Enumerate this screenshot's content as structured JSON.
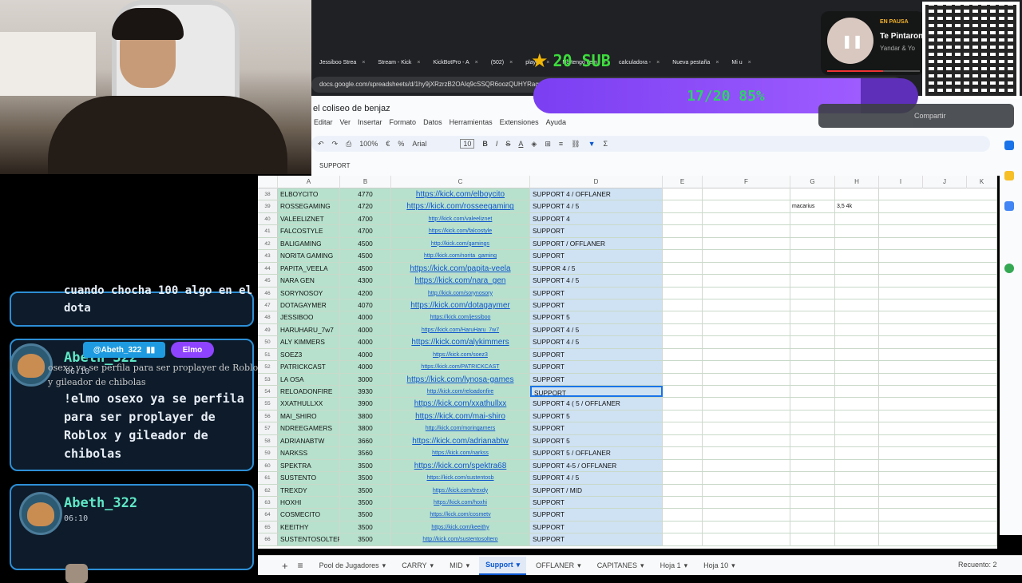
{
  "browser": {
    "tabs": [
      "Jessiboo Strea",
      "Stream - Kick",
      "KickBotPro - A",
      "(502)",
      "player",
      "No tengo tiem",
      "calculadora -",
      "Nueva pestaña",
      "Mi u"
    ],
    "url": "docs.google.com/spreadsheets/d/1hy9jXRzrzB2OAIq9cSSQR6oozQUHYRagcCXHCaafrF"
  },
  "doc": {
    "title": "el coliseo de benjaz",
    "menu": [
      "Editar",
      "Ver",
      "Insertar",
      "Formato",
      "Datos",
      "Herramientas",
      "Extensiones",
      "Ayuda"
    ],
    "zoom": "100%",
    "font": "Arial",
    "font_size": "10",
    "formula": "SUPPORT",
    "share_label": "Compartir"
  },
  "overlay": {
    "sub_goal": "20 SUB",
    "progress_text": "17/20  85%",
    "progress_fraction": 0.85,
    "music_status": "EN PAUSA",
    "music_title": "Te Pintaron",
    "music_artist": "Yandar & Yo"
  },
  "chat": {
    "m1_text": "cuando chocha 100 algo en el dota",
    "m2_user": "Abeth_322",
    "m2_pill_user": "@Abeth_322",
    "m2_pill_tts": "Elmo",
    "m2_tts": "osexo ya se perfila para ser proplayer de Roblox y gileador de chibolas",
    "m2_text": "!elmo osexo ya se perfila para ser proplayer de Roblox y gileador de chibolas",
    "m3_user": "Abeth_322",
    "m3_time": "06:10",
    "m2_time": "06:10"
  },
  "columns": [
    "A",
    "B",
    "C",
    "D",
    "E",
    "F",
    "G",
    "H",
    "I",
    "J",
    "K"
  ],
  "rows": [
    {
      "n": "38",
      "a": "ELBOYCITO",
      "b": "4770",
      "c": "https://kick.com/elboycito",
      "d": "SUPPORT 4 / OFFLANER",
      "s": "big"
    },
    {
      "n": "39",
      "a": "ROSSEGAMING",
      "b": "4720",
      "c": "https://kick.com/rosseegaming",
      "d": "SUPPORT 4 / 5",
      "s": "big",
      "g": "macarius",
      "h": "3,5 4k"
    },
    {
      "n": "40",
      "a": "VALEELIZNET",
      "b": "4700",
      "c": "http://kick.com/valeeliznet",
      "d": "SUPPORT 4",
      "s": "sm"
    },
    {
      "n": "41",
      "a": "FALCOSTYLE",
      "b": "4700",
      "c": "https://kick.com/falcostyle",
      "d": "SUPPORT",
      "s": "sm"
    },
    {
      "n": "42",
      "a": "BALIGAMING",
      "b": "4500",
      "c": "http://kick.com/gamings",
      "d": "SUPPORT / OFFLANER",
      "s": "sm"
    },
    {
      "n": "43",
      "a": "NORITA GAMING",
      "b": "4500",
      "c": "http://kick.com/norita_gaming",
      "d": "SUPPORT",
      "s": "sm"
    },
    {
      "n": "44",
      "a": "PAPITA_VEELA",
      "b": "4500",
      "c": "https://kick.com/papita-veela",
      "d": "SUPPOR 4 / 5",
      "s": "big"
    },
    {
      "n": "45",
      "a": "NARA GEN",
      "b": "4300",
      "c": "https://kick.com/nara_gen",
      "d": "SUPPORT 4 / 5",
      "s": "big"
    },
    {
      "n": "46",
      "a": "SORYNOSOY",
      "b": "4200",
      "c": "http://kick.com/sorynosory",
      "d": "SUPPORT",
      "s": "sm"
    },
    {
      "n": "47",
      "a": "DOTAGAYMER",
      "b": "4070",
      "c": "https://kick.com/dotagaymer",
      "d": "SUPPORT",
      "s": "big"
    },
    {
      "n": "48",
      "a": "JESSIBOO",
      "b": "4000",
      "c": "https://kick.com/jessiboo",
      "d": "SUPPORT 5",
      "s": "sm"
    },
    {
      "n": "49",
      "a": "HARUHARU_7w7",
      "b": "4000",
      "c": "https://kick.com/HaruHaru_7w7",
      "d": "SUPPORT 4 / 5",
      "s": "sm"
    },
    {
      "n": "50",
      "a": "ALY KIMMERS",
      "b": "4000",
      "c": "https://kick.com/alykimmers",
      "d": "SUPPORT 4 / 5",
      "s": "big"
    },
    {
      "n": "51",
      "a": "SOEZ3",
      "b": "4000",
      "c": "https://kick.com/soez3",
      "d": "SUPPORT",
      "s": "sm"
    },
    {
      "n": "52",
      "a": "PATRICKCAST",
      "b": "4000",
      "c": "https://kick.com/PATRICKCAST",
      "d": "SUPPORT",
      "s": "sm"
    },
    {
      "n": "53",
      "a": "LA OSA",
      "b": "3000",
      "c": "https://kick.com/lynosa-games",
      "d": "SUPPORT",
      "s": "big"
    },
    {
      "n": "54",
      "a": "RELOADONFIRE",
      "b": "3930",
      "c": "http://kick.com/reloadonfire",
      "d": "SUPPORT",
      "s": "sm"
    },
    {
      "n": "55",
      "a": "XXATHULLXX",
      "b": "3900",
      "c": "https://kick.com/xxathullxx",
      "d": "SUPPORT 4 ( 5 / OFFLANER",
      "s": "big"
    },
    {
      "n": "56",
      "a": "MAI_SHIRO",
      "b": "3800",
      "c": "https://kick.com/mai-shiro",
      "d": "SUPPORT 5",
      "s": "big"
    },
    {
      "n": "57",
      "a": "NDREEGAMERS",
      "b": "3800",
      "c": "http://kick.com/moringamers",
      "d": "SUPPORT",
      "s": "sm"
    },
    {
      "n": "58",
      "a": "ADRIANABTW",
      "b": "3660",
      "c": "https://kick.com/adrianabtw",
      "d": "SUPPORT 5",
      "s": "big"
    },
    {
      "n": "59",
      "a": "NARKSS",
      "b": "3560",
      "c": "https://kick.com/narkss",
      "d": "SUPPORT 5 / OFFLANER",
      "s": "sm"
    },
    {
      "n": "60",
      "a": "SPEKTRA",
      "b": "3500",
      "c": "https://kick.com/spektra68",
      "d": "SUPPORT 4-5 / OFFLANER",
      "s": "big"
    },
    {
      "n": "61",
      "a": "SUSTENTO",
      "b": "3500",
      "c": "https://kick.com/sustentosb",
      "d": "SUPPORT 4 / 5",
      "s": "sm"
    },
    {
      "n": "62",
      "a": "TREXDY",
      "b": "3500",
      "c": "https://kick.com/trexdy",
      "d": "SUPPORT / MID",
      "s": "sm"
    },
    {
      "n": "63",
      "a": "HOXHI",
      "b": "3500",
      "c": "https://kick.com/hoxhi",
      "d": "SUPPORT",
      "s": "sm"
    },
    {
      "n": "64",
      "a": "COSMECITO",
      "b": "3500",
      "c": "https://kick.com/cosmetv",
      "d": "SUPPORT",
      "s": "sm"
    },
    {
      "n": "65",
      "a": "KEEITHY",
      "b": "3500",
      "c": "https://kick.com/keeithy",
      "d": "SUPPORT",
      "s": "sm"
    },
    {
      "n": "66",
      "a": "SUSTENTOSOLTERO",
      "b": "3500",
      "c": "http://kick.com/sustentosoltero",
      "d": "SUPPORT",
      "s": "sm"
    }
  ],
  "sheets": [
    "Pool de Jugadores",
    "CARRY",
    "MID",
    "Support",
    "OFFLANER",
    "CAPITANES",
    "Hoja 1",
    "Hoja 10"
  ],
  "active_sheet": "Support",
  "status": "Recuento: 2",
  "colors": {
    "green_cell": "#b7e1cd",
    "blue_cell": "#cfe2f3",
    "link": "#1155cc",
    "progress": "#7b3ff2",
    "progress_text": "#2ed16a",
    "chat_border": "#2d8fd6",
    "username": "#5fe7c6"
  }
}
